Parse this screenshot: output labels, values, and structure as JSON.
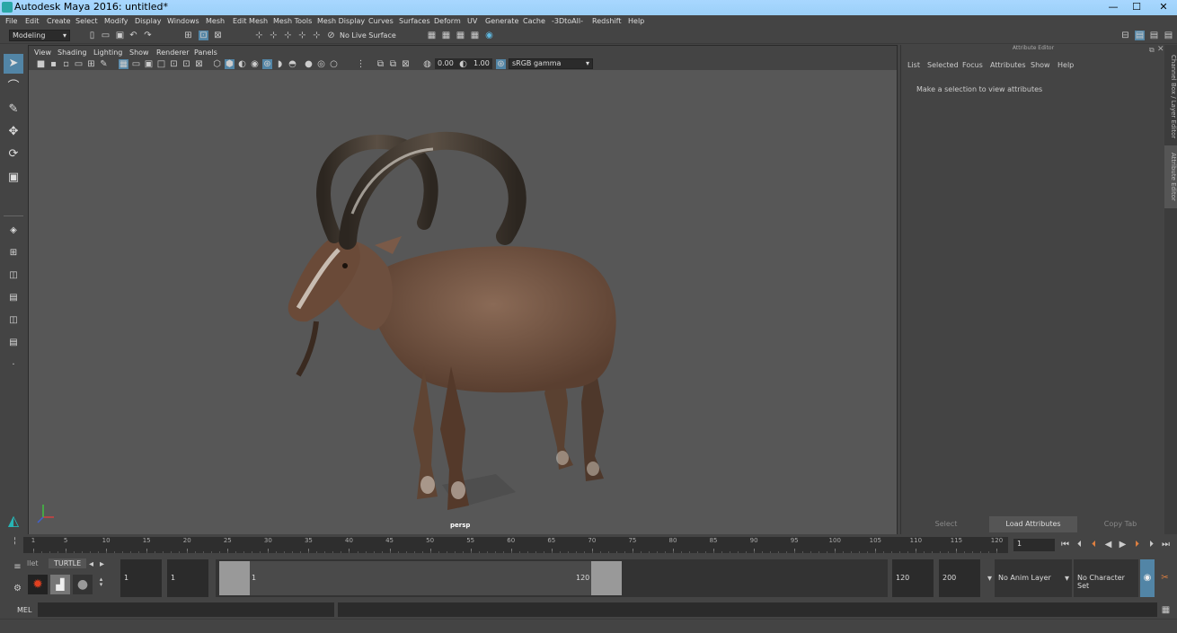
{
  "window": {
    "title": "Autodesk Maya 2016: untitled*",
    "min": "—",
    "max": "☐",
    "close": "✕"
  },
  "menu": [
    "File",
    "Edit",
    "Create",
    "Select",
    "Modify",
    "Display",
    "Windows",
    "Mesh",
    "Edit Mesh",
    "Mesh Tools",
    "Mesh Display",
    "Curves",
    "Surfaces",
    "Deform",
    "UV",
    "Generate",
    "Cache",
    "-3DtoAll-",
    "Redshift",
    "Help"
  ],
  "toolbar": {
    "mode": "Modeling",
    "live_surface": "No Live Surface"
  },
  "viewport": {
    "menu": [
      "View",
      "Shading",
      "Lighting",
      "Show",
      "Renderer",
      "Panels"
    ],
    "exposure": "0.00",
    "gamma": "1.00",
    "color_space": "sRGB gamma",
    "camera": "persp"
  },
  "attribute_editor": {
    "header": "Attribute Editor",
    "menu": [
      "List",
      "Selected",
      "Focus",
      "Attributes",
      "Show",
      "Help"
    ],
    "message": "Make a selection to view attributes",
    "buttons": [
      "Select",
      "Load Attributes",
      "Copy Tab"
    ]
  },
  "side_tabs": [
    "Channel Box / Layer Editor",
    "Attribute Editor"
  ],
  "timeline": {
    "ticks": [
      1,
      5,
      10,
      15,
      20,
      25,
      30,
      35,
      40,
      45,
      50,
      55,
      60,
      65,
      70,
      75,
      80,
      85,
      90,
      95,
      100,
      105,
      110,
      115,
      120
    ],
    "current_frame": "1"
  },
  "range": {
    "shelf_tabs": [
      "llet",
      "TURTLE"
    ],
    "start": "1",
    "start2": "1",
    "slider_start": "1",
    "slider_end": "120",
    "end": "120",
    "end2": "200",
    "anim_layer": "No Anim Layer",
    "char_set": "No Character Set"
  },
  "mel": {
    "label": "MEL"
  },
  "colors": {
    "viewport_bg": "#575757",
    "accent_blue": "#5285a6"
  }
}
